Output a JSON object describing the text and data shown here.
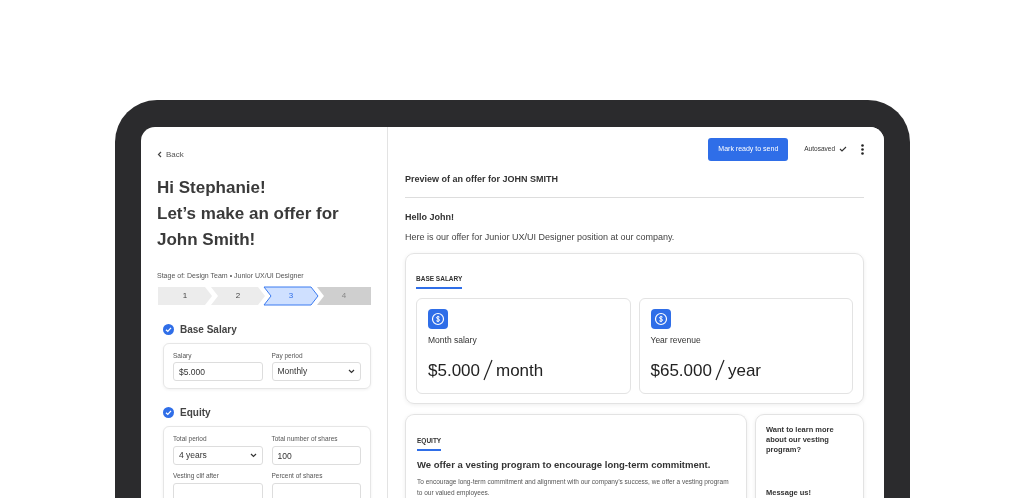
{
  "left_panel": {
    "back": "Back",
    "heading_lines": [
      "Hi Stephanie!",
      "Let’s make an offer for",
      "John Smith!"
    ],
    "stage_label": "Stage of: Design Team • Junior UX/UI Designer",
    "steps": [
      {
        "label": "1",
        "selected": false,
        "disabled": false
      },
      {
        "label": "2",
        "selected": false,
        "disabled": false
      },
      {
        "label": "3",
        "selected": true,
        "disabled": false
      },
      {
        "label": "4",
        "selected": false,
        "disabled": true
      }
    ],
    "sections": [
      {
        "title": "Base Salary",
        "checked": true,
        "fields": [
          {
            "label": "Salary",
            "kind": "text",
            "value": "$5.000"
          },
          {
            "label": "Pay period",
            "kind": "select",
            "value": "Monthly"
          }
        ]
      },
      {
        "title": "Equity",
        "checked": true,
        "fields": [
          {
            "label": "Total period",
            "kind": "select",
            "value": "4 years"
          },
          {
            "label": "Total number of shares",
            "kind": "text",
            "value": "100"
          },
          {
            "label": "Vesting clif after",
            "kind": "text"
          },
          {
            "label": "Percent of shares",
            "kind": "text"
          }
        ]
      }
    ]
  },
  "preview": {
    "primary_button": "Mark ready to send",
    "autosave_status": "Autosaved",
    "title": "Preview of an offer for JOHN SMITH",
    "greeting": "Hello John!",
    "intro": "Here is our offer for Junior UX/UI Designer position at our company.",
    "base_salary": {
      "heading": "BASE SALARY",
      "tiles": [
        {
          "label": "Month salary",
          "amount": "$5.000",
          "unit": "month"
        },
        {
          "label": "Year revenue",
          "amount": "$65.000",
          "unit": "year"
        }
      ]
    },
    "equity": {
      "heading": "EQUITY",
      "title": "We offer a vesting program to encourage long-term commitment.",
      "text": "To encourage long-term commitment and alignment with our company’s success, we offer a vesting program to our valued employees."
    },
    "help_card": {
      "question": "Want to learn more about our vesting program?",
      "link": "Message us!"
    }
  }
}
